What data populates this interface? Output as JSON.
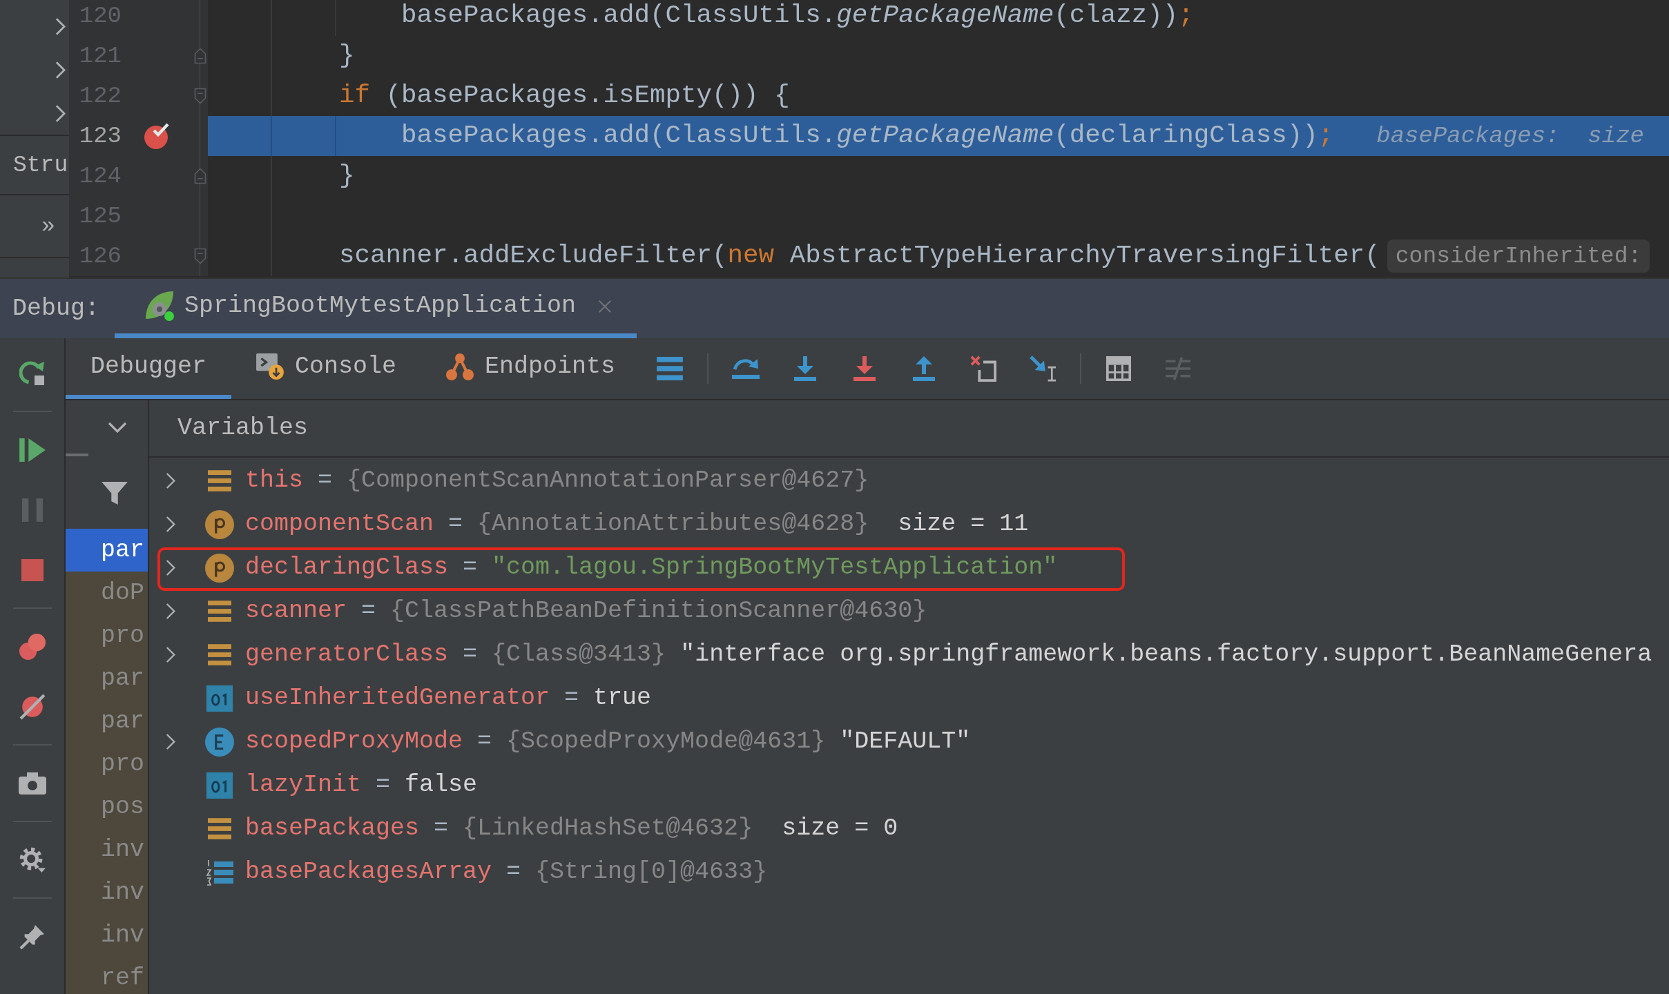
{
  "project_strip": {
    "structure_label": "Stru",
    "more_label": "»"
  },
  "editor": {
    "lines": [
      {
        "number": "120",
        "fold_start": false,
        "fold_end": false,
        "breakpoint": false,
        "current": false,
        "tokens": [
          {
            "text": "        basePackages.add(ClassUtils.",
            "kind": "plain"
          },
          {
            "text": "getPackageName",
            "kind": "static"
          },
          {
            "text": "(clazz))",
            "kind": "plain"
          },
          {
            "text": ";",
            "kind": "keyword"
          }
        ]
      },
      {
        "number": "121",
        "fold_start": false,
        "fold_end": true,
        "breakpoint": false,
        "current": false,
        "tokens": [
          {
            "text": "    }",
            "kind": "plain"
          }
        ]
      },
      {
        "number": "122",
        "fold_start": true,
        "fold_end": false,
        "breakpoint": false,
        "current": false,
        "tokens": [
          {
            "text": "    if",
            "kind": "keyword"
          },
          {
            "text": " (basePackages.isEmpty()) {",
            "kind": "plain"
          }
        ]
      },
      {
        "number": "123",
        "fold_start": false,
        "fold_end": false,
        "breakpoint": true,
        "current": true,
        "tokens": [
          {
            "text": "        basePackages.add(ClassUtils.",
            "kind": "plain"
          },
          {
            "text": "getPackageName",
            "kind": "static"
          },
          {
            "text": "(declaringClass))",
            "kind": "plain"
          },
          {
            "text": ";",
            "kind": "keyword"
          }
        ],
        "hint": {
          "kind": "inline",
          "text": "basePackages:  size"
        }
      },
      {
        "number": "124",
        "fold_start": false,
        "fold_end": true,
        "breakpoint": false,
        "current": false,
        "tokens": [
          {
            "text": "    }",
            "kind": "plain"
          }
        ]
      },
      {
        "number": "125",
        "fold_start": false,
        "fold_end": false,
        "breakpoint": false,
        "current": false
      },
      {
        "number": "126",
        "fold_start": true,
        "fold_end": false,
        "breakpoint": false,
        "current": false,
        "tokens": [
          {
            "text": "    scanner.addExcludeFilter(",
            "kind": "plain"
          },
          {
            "text": "new",
            "kind": "keyword"
          },
          {
            "text": " AbstractTypeHierarchyTraversingFilter(",
            "kind": "plain"
          }
        ],
        "hint": {
          "kind": "parameter",
          "text": "considerInherited:"
        }
      }
    ]
  },
  "debug_panel": {
    "label": "Debug:",
    "sessions": [
      {
        "label": "SpringBootMytestApplication",
        "selected": true
      }
    ]
  },
  "side_toolbar": {
    "groups": [
      [
        {
          "kind": "rerun",
          "disabled": false
        }
      ],
      [
        {
          "kind": "resume",
          "disabled": false
        },
        {
          "kind": "pause",
          "disabled": true
        },
        {
          "kind": "stop",
          "disabled": false
        }
      ],
      [
        {
          "kind": "breakpoints",
          "disabled": false
        },
        {
          "kind": "mute",
          "disabled": false
        }
      ],
      [
        {
          "kind": "snapshot",
          "disabled": false
        }
      ],
      [
        {
          "kind": "settings",
          "disabled": false
        }
      ],
      [
        {
          "kind": "pin",
          "disabled": false
        }
      ]
    ]
  },
  "tabs": [
    {
      "label": "Debugger",
      "kind": "plain",
      "selected": true
    },
    {
      "label": "Console",
      "kind": "console",
      "selected": false
    },
    {
      "label": "Endpoints",
      "kind": "endpoints",
      "selected": false
    }
  ],
  "toolbar": {
    "groups": [
      [
        {
          "kind": "layout",
          "disabled": false
        }
      ],
      [
        {
          "kind": "stepover",
          "disabled": false
        },
        {
          "kind": "stepinto",
          "disabled": false
        },
        {
          "kind": "forcestepinto",
          "disabled": false
        },
        {
          "kind": "stepout",
          "disabled": false
        },
        {
          "kind": "dropframe",
          "disabled": false
        },
        {
          "kind": "runtocursor",
          "disabled": false
        }
      ],
      [
        {
          "kind": "evaluate",
          "disabled": false
        },
        {
          "kind": "trace",
          "disabled": true
        }
      ]
    ]
  },
  "frames": [
    {
      "label": "par",
      "selected": true,
      "library": false
    },
    {
      "label": "doP",
      "selected": false,
      "library": true
    },
    {
      "label": "pro",
      "selected": false,
      "library": true
    },
    {
      "label": "par",
      "selected": false,
      "library": true
    },
    {
      "label": "par",
      "selected": false,
      "library": true
    },
    {
      "label": "pro",
      "selected": false,
      "library": true
    },
    {
      "label": "pos",
      "selected": false,
      "library": true
    },
    {
      "label": "inv",
      "selected": false,
      "library": true
    },
    {
      "label": "inv",
      "selected": false,
      "library": true
    },
    {
      "label": "inv",
      "selected": false,
      "library": true
    },
    {
      "label": "ref",
      "selected": false,
      "library": true
    }
  ],
  "variables": {
    "title": "Variables",
    "items": [
      {
        "name": "this",
        "kind": "object",
        "expandable": true,
        "outlined": false,
        "eq": "=",
        "value": [
          {
            "text": "{ComponentScanAnnotationParser@4627}",
            "kind": "ref"
          }
        ]
      },
      {
        "name": "componentScan",
        "kind": "param",
        "expandable": true,
        "outlined": false,
        "eq": "=",
        "value": [
          {
            "text": "{AnnotationAttributes@4628}",
            "kind": "ref"
          },
          {
            "text": "size = 11",
            "kind": "size"
          }
        ]
      },
      {
        "name": "declaringClass",
        "kind": "param",
        "expandable": true,
        "outlined": true,
        "eq": "=",
        "value": [
          {
            "text": "\"com.lagou.SpringBootMyTestApplication\"",
            "kind": "string"
          }
        ]
      },
      {
        "name": "scanner",
        "kind": "object",
        "expandable": true,
        "outlined": false,
        "eq": "=",
        "value": [
          {
            "text": "{ClassPathBeanDefinitionScanner@4630}",
            "kind": "ref"
          }
        ]
      },
      {
        "name": "generatorClass",
        "kind": "object",
        "expandable": true,
        "outlined": false,
        "eq": "=",
        "value": [
          {
            "text": "{Class@3413}",
            "kind": "ref"
          },
          {
            "text": "\"interface org.springframework.beans.factory.support.BeanNameGenera",
            "kind": "plain"
          }
        ]
      },
      {
        "name": "useInheritedGenerator",
        "kind": "primitive",
        "expandable": false,
        "outlined": false,
        "eq": "=",
        "value": [
          {
            "text": "true",
            "kind": "plain"
          }
        ]
      },
      {
        "name": "scopedProxyMode",
        "kind": "enum",
        "expandable": true,
        "outlined": false,
        "eq": "=",
        "value": [
          {
            "text": "{ScopedProxyMode@4631}",
            "kind": "ref"
          },
          {
            "text": "\"DEFAULT\"",
            "kind": "plain"
          }
        ]
      },
      {
        "name": "lazyInit",
        "kind": "primitive",
        "expandable": false,
        "outlined": false,
        "eq": "=",
        "value": [
          {
            "text": "false",
            "kind": "plain"
          }
        ]
      },
      {
        "name": "basePackages",
        "kind": "object",
        "expandable": false,
        "outlined": false,
        "eq": "=",
        "value": [
          {
            "text": "{LinkedHashSet@4632}",
            "kind": "ref"
          },
          {
            "text": "size = 0",
            "kind": "size"
          }
        ]
      },
      {
        "name": "basePackagesArray",
        "kind": "array",
        "expandable": false,
        "outlined": false,
        "eq": "=",
        "value": [
          {
            "text": "{String[0]@4633}",
            "kind": "ref"
          }
        ]
      }
    ]
  }
}
